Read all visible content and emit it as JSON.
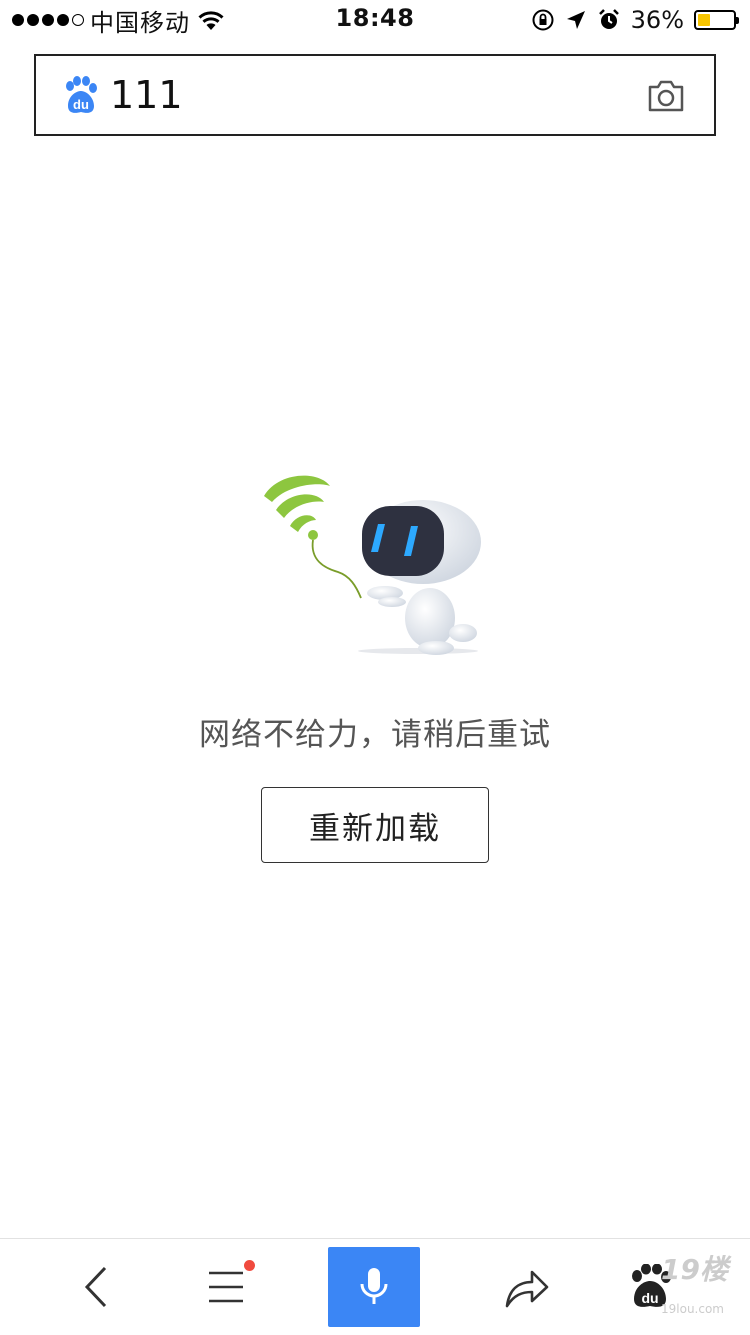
{
  "status_bar": {
    "carrier": "中国移动",
    "time": "18:48",
    "battery_percent": "36%",
    "battery_level": 0.36,
    "signal_bars": 4,
    "icons": [
      "wifi-icon",
      "rotation-lock-icon",
      "location-icon",
      "alarm-icon"
    ]
  },
  "search": {
    "logo_text": "du",
    "query": "111",
    "camera_icon": "camera-icon"
  },
  "error": {
    "message": "网络不给力，请稍后重试",
    "reload_label": "重新加载"
  },
  "toolbar": {
    "items": [
      "back-icon",
      "menu-icon",
      "microphone-icon",
      "share-icon",
      "baidu-paw-icon"
    ],
    "menu_badge": true
  },
  "watermark": {
    "text": "19楼",
    "sub": "19lou.com"
  },
  "colors": {
    "accent": "#3b86f5",
    "badge": "#f04a3e",
    "battery": "#f6c400",
    "wifi_green": "#8dc63f"
  }
}
